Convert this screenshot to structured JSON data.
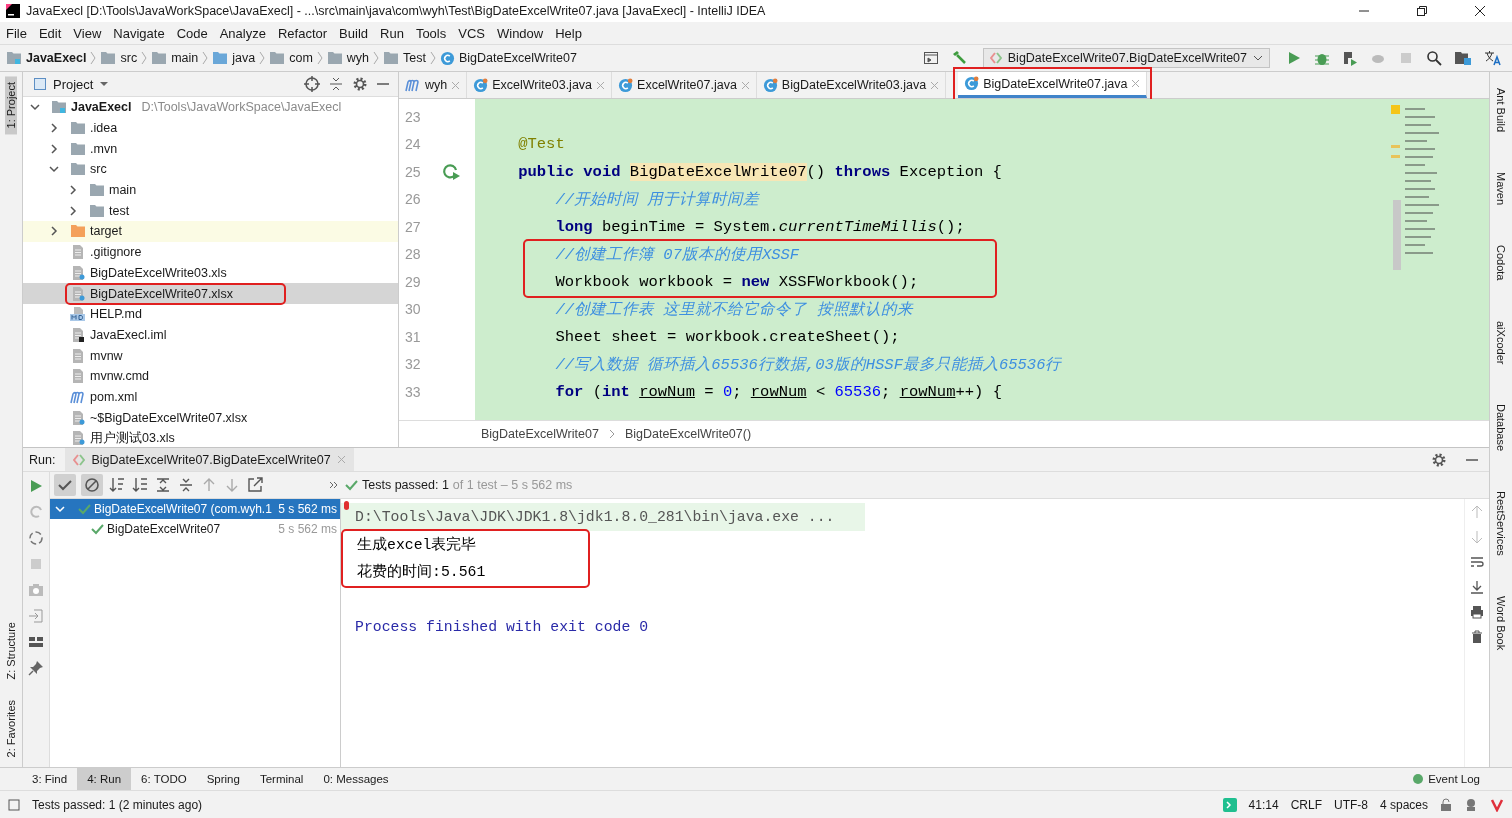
{
  "window": {
    "title": "JavaExecl [D:\\Tools\\JavaWorkSpace\\JavaExecl] - ...\\src\\main\\java\\com\\wyh\\Test\\BigDateExcelWrite07.java [JavaExecl] - IntelliJ IDEA"
  },
  "menu": [
    "File",
    "Edit",
    "View",
    "Navigate",
    "Code",
    "Analyze",
    "Refactor",
    "Build",
    "Run",
    "Tools",
    "VCS",
    "Window",
    "Help"
  ],
  "navbar": {
    "crumbs": [
      {
        "label": "JavaExecl",
        "kind": "project"
      },
      {
        "label": "src",
        "kind": "folder"
      },
      {
        "label": "main",
        "kind": "folder"
      },
      {
        "label": "java",
        "kind": "source"
      },
      {
        "label": "com",
        "kind": "package"
      },
      {
        "label": "wyh",
        "kind": "package"
      },
      {
        "label": "Test",
        "kind": "package"
      },
      {
        "label": "BigDateExcelWrite07",
        "kind": "class"
      }
    ],
    "run_config": "BigDateExcelWrite07.BigDateExcelWrite07"
  },
  "left_tools_top": [
    {
      "label": "1: Project",
      "selected": true
    }
  ],
  "left_tools_bottom": [
    {
      "label": "Z: Structure",
      "selected": false
    },
    {
      "label": "2: Favorites",
      "selected": false
    }
  ],
  "right_tools": [
    "Ant Build",
    "Maven",
    "Codota",
    "aiXcoder",
    "Database",
    "RestServices",
    "Word Book"
  ],
  "project": {
    "title": "Project",
    "tree": [
      {
        "label": "JavaExecl",
        "path": "D:\\Tools\\JavaWorkSpace\\JavaExecl",
        "kind": "project",
        "expanded": true,
        "selected": false,
        "children": [
          {
            "label": ".idea",
            "kind": "folder",
            "expanded": false,
            "selected": false
          },
          {
            "label": ".mvn",
            "kind": "folder",
            "expanded": false,
            "selected": false
          },
          {
            "label": "src",
            "kind": "folder",
            "expanded": true,
            "selected": false,
            "children": [
              {
                "label": "main",
                "kind": "folder",
                "expanded": false,
                "selected": false
              },
              {
                "label": "test",
                "kind": "folder",
                "expanded": false,
                "selected": false
              }
            ]
          },
          {
            "label": "target",
            "kind": "excluded",
            "expanded": false,
            "selected": false
          },
          {
            "label": ".gitignore",
            "kind": "text",
            "selected": false
          },
          {
            "label": "BigDateExcelWrite03.xls",
            "kind": "unknown",
            "selected": false
          },
          {
            "label": "BigDateExcelWrite07.xlsx",
            "kind": "unknown",
            "selected": true,
            "highlighted": true
          },
          {
            "label": "HELP.md",
            "kind": "markdown",
            "selected": false
          },
          {
            "label": "JavaExecl.iml",
            "kind": "module",
            "selected": false
          },
          {
            "label": "mvnw",
            "kind": "text",
            "selected": false
          },
          {
            "label": "mvnw.cmd",
            "kind": "text",
            "selected": false
          },
          {
            "label": "pom.xml",
            "kind": "maven",
            "selected": false
          },
          {
            "label": "~$BigDateExcelWrite07.xlsx",
            "kind": "unknown",
            "selected": false
          },
          {
            "label": "用户测试03.xls",
            "kind": "unknown",
            "selected": false
          }
        ]
      }
    ]
  },
  "editor": {
    "tabs": [
      {
        "label": "wyh",
        "kind": "maven",
        "selected": false
      },
      {
        "label": "ExcelWrite03.java",
        "kind": "class",
        "selected": false
      },
      {
        "label": "ExcelWrite07.java",
        "kind": "class",
        "selected": false
      },
      {
        "label": "BigDateExcelWrite03.java",
        "kind": "class",
        "selected": false
      },
      {
        "label": "BigDateExcelWrite07.java",
        "kind": "class",
        "selected": true,
        "highlighted": true
      }
    ],
    "lines": [
      {
        "number": "23",
        "run": false,
        "highlighted": false
      },
      {
        "number": "24",
        "run": false,
        "highlighted": false,
        "tokens": [
          {
            "t": "    @Test",
            "kind": "annotation"
          }
        ]
      },
      {
        "number": "25",
        "run": true,
        "highlighted": false,
        "tokens": [
          {
            "t": "    public void ",
            "kind": "keyword"
          },
          {
            "t": "BigDateExcelWrite07",
            "kind": "declaration"
          },
          {
            "t": "() ",
            "kind": "plain"
          },
          {
            "t": "throws",
            "kind": "keyword"
          },
          {
            "t": " Exception {",
            "kind": "plain"
          }
        ]
      },
      {
        "number": "26",
        "run": false,
        "highlighted": false,
        "tokens": [
          {
            "t": "        //开始时间 用于计算时间差",
            "kind": "comment"
          }
        ]
      },
      {
        "number": "27",
        "run": false,
        "highlighted": false,
        "tokens": [
          {
            "t": "        long ",
            "kind": "keyword"
          },
          {
            "t": "beginTime = System.",
            "kind": "plain"
          },
          {
            "t": "currentTimeMillis",
            "kind": "static"
          },
          {
            "t": "();",
            "kind": "plain"
          }
        ]
      },
      {
        "number": "28",
        "run": false,
        "highlighted": true,
        "tokens": [
          {
            "t": "        //创建工作簿 07版本的使用XSSF",
            "kind": "comment"
          }
        ]
      },
      {
        "number": "29",
        "run": false,
        "highlighted": true,
        "tokens": [
          {
            "t": "        Workbook workbook = ",
            "kind": "plain"
          },
          {
            "t": "new",
            "kind": "keyword"
          },
          {
            "t": " XSSFWorkbook();",
            "kind": "plain"
          }
        ]
      },
      {
        "number": "30",
        "run": false,
        "highlighted": false,
        "tokens": [
          {
            "t": "        //创建工作表 这里就不给它命令了 按照默认的来",
            "kind": "comment"
          }
        ]
      },
      {
        "number": "31",
        "run": false,
        "highlighted": false,
        "tokens": [
          {
            "t": "        Sheet sheet = workbook.createSheet();",
            "kind": "plain"
          }
        ]
      },
      {
        "number": "32",
        "run": false,
        "highlighted": false,
        "tokens": [
          {
            "t": "        //写入数据 循环插入65536行数据,03版的HSSF最多只能插入65536行",
            "kind": "comment"
          }
        ]
      },
      {
        "number": "33",
        "run": false,
        "highlighted": false,
        "tokens": [
          {
            "t": "        for",
            "kind": "keyword"
          },
          {
            "t": " (",
            "kind": "plain"
          },
          {
            "t": "int ",
            "kind": "keyword"
          },
          {
            "t": "rowNum",
            "kind": "variable"
          },
          {
            "t": " = ",
            "kind": "plain"
          },
          {
            "t": "0",
            "kind": "number"
          },
          {
            "t": "; ",
            "kind": "plain"
          },
          {
            "t": "rowNum",
            "kind": "variable"
          },
          {
            "t": " < ",
            "kind": "plain"
          },
          {
            "t": "65536",
            "kind": "number"
          },
          {
            "t": "; ",
            "kind": "plain"
          },
          {
            "t": "rowNum",
            "kind": "variable"
          },
          {
            "t": "++) {",
            "kind": "plain"
          }
        ]
      }
    ],
    "breadcrumb": [
      "BigDateExcelWrite07",
      "BigDateExcelWrite07()"
    ]
  },
  "run": {
    "label": "Run:",
    "tab": "BigDateExcelWrite07.BigDateExcelWrite07",
    "status_label": "Tests passed: 1",
    "status_detail": "of 1 test – 5 s 562 ms",
    "tests": [
      {
        "label": "BigDateExcelWrite07 (com.wyh.1",
        "time": "5 s 562 ms",
        "selected": true,
        "expanded": true,
        "children": [
          {
            "label": "BigDateExcelWrite07",
            "time": "5 s 562 ms",
            "selected": false
          }
        ]
      }
    ],
    "console": [
      {
        "text": "D:\\Tools\\Java\\JDK\\JDK1.8\\jdk1.8.0_281\\bin\\java.exe ...",
        "kind": "command",
        "highlighted": false
      },
      {
        "text": "生成excel表完毕",
        "kind": "output",
        "highlighted": true
      },
      {
        "text": "花费的时间:5.561",
        "kind": "output",
        "highlighted": true
      },
      {
        "kind": "blank",
        "highlighted": false
      },
      {
        "text": "Process finished with exit code 0",
        "kind": "exit",
        "highlighted": false
      }
    ]
  },
  "tool_tabs": [
    {
      "label": "3: Find",
      "selected": false
    },
    {
      "label": "4: Run",
      "selected": true
    },
    {
      "label": "6: TODO",
      "selected": false
    },
    {
      "label": "Spring",
      "selected": false
    },
    {
      "label": "Terminal",
      "selected": false
    },
    {
      "label": "0: Messages",
      "selected": false
    }
  ],
  "event_log": "Event Log",
  "status_bar": {
    "message": "Tests passed: 1 (2 minutes ago)",
    "position": "41:14",
    "line_separator": "CRLF",
    "encoding": "UTF-8",
    "indent": "4 spaces"
  }
}
